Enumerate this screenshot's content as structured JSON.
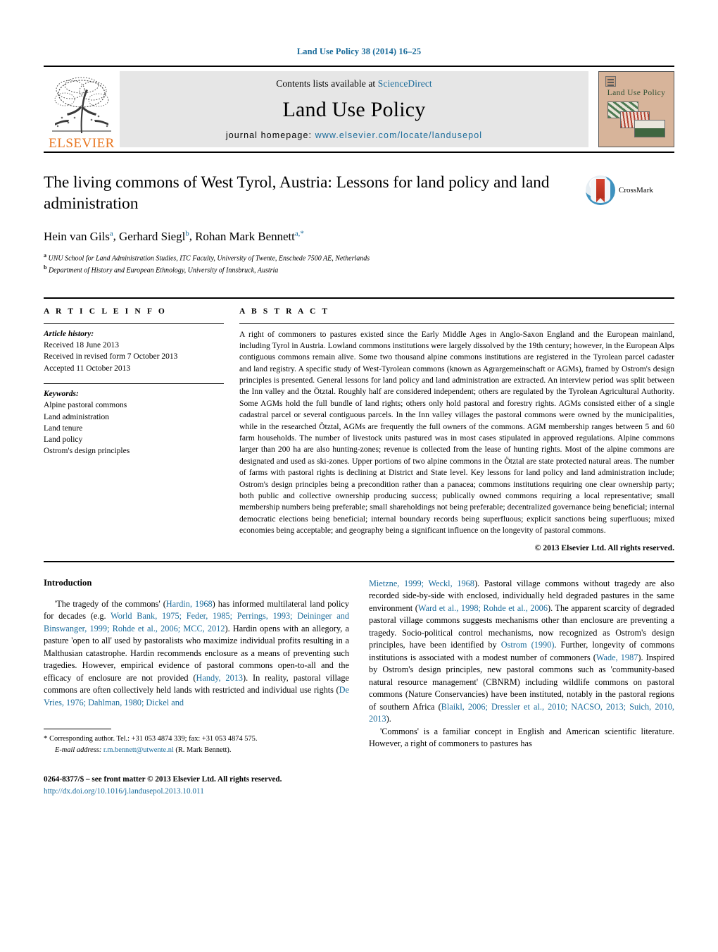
{
  "running_head": "Land Use Policy 38 (2014) 16–25",
  "masthead": {
    "publisher_name": "ELSEVIER",
    "contents_prefix": "Contents lists available at ",
    "contents_link": "ScienceDirect",
    "journal_title": "Land Use Policy",
    "homepage_prefix": "journal homepage: ",
    "homepage_url": "www.elsevier.com/locate/landusepol",
    "cover_title": "Land Use Policy"
  },
  "article": {
    "title": "The living commons of West Tyrol, Austria: Lessons for land policy and land administration",
    "authors": [
      {
        "name": "Hein van Gils",
        "marks": "a"
      },
      {
        "name": "Gerhard Siegl",
        "marks": "b"
      },
      {
        "name": "Rohan Mark Bennett",
        "marks": "a,*"
      }
    ],
    "authors_line_plain": "Hein van Gils a, Gerhard Siegl b, Rohan Mark Bennett a,*",
    "affiliations": [
      {
        "mark": "a",
        "text": "UNU School for Land Administration Studies, ITC Faculty, University of Twente, Enschede 7500 AE, Netherlands"
      },
      {
        "mark": "b",
        "text": "Department of History and European Ethnology, University of Innsbruck, Austria"
      }
    ],
    "crossmark_label": "CrossMark"
  },
  "article_info": {
    "heading": "A R T I C L E   I N F O",
    "history_label": "Article history:",
    "history": [
      "Received 18 June 2013",
      "Received in revised form 7 October 2013",
      "Accepted 11 October 2013"
    ],
    "keywords_label": "Keywords:",
    "keywords": [
      "Alpine pastoral commons",
      "Land administration",
      "Land tenure",
      "Land policy",
      "Ostrom's design principles"
    ]
  },
  "abstract": {
    "heading": "A B S T R A C T",
    "text": "A right of commoners to pastures existed since the Early Middle Ages in Anglo-Saxon England and the European mainland, including Tyrol in Austria. Lowland commons institutions were largely dissolved by the 19th century; however, in the European Alps contiguous commons remain alive. Some two thousand alpine commons institutions are registered in the Tyrolean parcel cadaster and land registry. A specific study of West-Tyrolean commons (known as Agrargemeinschaft or AGMs), framed by Ostrom's design principles is presented. General lessons for land policy and land administration are extracted. An interview period was split between the Inn valley and the Ötztal. Roughly half are considered independent; others are regulated by the Tyrolean Agricultural Authority. Some AGMs hold the full bundle of land rights; others only hold pastoral and forestry rights. AGMs consisted either of a single cadastral parcel or several contiguous parcels. In the Inn valley villages the pastoral commons were owned by the municipalities, while in the researched Ötztal, AGMs are frequently the full owners of the commons. AGM membership ranges between 5 and 60 farm households. The number of livestock units pastured was in most cases stipulated in approved regulations. Alpine commons larger than 200 ha are also hunting-zones; revenue is collected from the lease of hunting rights. Most of the alpine commons are designated and used as ski-zones. Upper portions of two alpine commons in the Ötztal are state protected natural areas. The number of farms with pastoral rights is declining at District and State level. Key lessons for land policy and land administration include; Ostrom's design principles being a precondition rather than a panacea; commons institutions requiring one clear ownership party; both public and collective ownership producing success; publically owned commons requiring a local representative; small membership numbers being preferable; small shareholdings not being preferable; decentralized governance being beneficial; internal democratic elections being beneficial; internal boundary records being superfluous; explicit sanctions being superfluous; mixed economies being acceptable; and geography being a significant influence on the longevity of pastoral commons.",
    "copyright": "© 2013 Elsevier Ltd. All rights reserved."
  },
  "introduction": {
    "heading": "Introduction",
    "left_paragraph_1": "'The tragedy of the commons' (Hardin, 1968) has informed multilateral land policy for decades (e.g. World Bank, 1975; Feder, 1985; Perrings, 1993; Deininger and Binswanger, 1999; Rohde et al., 2006; MCC, 2012). Hardin opens with an allegory, a pasture 'open to all' used by pastoralists who maximize individual profits resulting in a Malthusian catastrophe. Hardin recommends enclosure as a means of preventing such tragedies. However, empirical evidence of pastoral commons open-to-all and the efficacy of enclosure are not provided (Handy, 2013). In reality, pastoral village commons are often collectively held lands with restricted and individual use rights (De Vries, 1976; Dahlman, 1980; Dickel and",
    "right_paragraph_1": "Mietzne, 1999; Weckl, 1968). Pastoral village commons without tragedy are also recorded side-by-side with enclosed, individually held degraded pastures in the same environment (Ward et al., 1998; Rohde et al., 2006). The apparent scarcity of degraded pastoral village commons suggests mechanisms other than enclosure are preventing a tragedy. Socio-political control mechanisms, now recognized as Ostrom's design principles, have been identified by Ostrom (1990). Further, longevity of commons institutions is associated with a modest number of commoners (Wade, 1987). Inspired by Ostrom's design principles, new pastoral commons such as 'community-based natural resource management' (CBNRM) including wildlife commons on pastoral commons (Nature Conservancies) have been instituted, notably in the pastoral regions of southern Africa (Blaikl, 2006; Dressler et al., 2010; NACSO, 2013; Suich, 2010, 2013).",
    "right_paragraph_2": "'Commons' is a familiar concept in English and American scientific literature. However, a right of commoners to pastures has"
  },
  "footnote": {
    "star": "*",
    "corresponding": "Corresponding author. Tel.: +31 053 4874 339; fax: +31 053 4874 575.",
    "email_label": "E-mail address:",
    "email": "r.m.bennett@utwente.nl",
    "email_owner": "(R. Mark Bennett)."
  },
  "footer": {
    "issn_line": "0264-8377/$ – see front matter © 2013 Elsevier Ltd. All rights reserved.",
    "doi": "http://dx.doi.org/10.1016/j.landusepol.2013.10.011"
  },
  "colors": {
    "link": "#1a6b9a",
    "elsevier_orange": "#E87722",
    "band_gray": "#e6e6e6",
    "cover_tan": "#d7b49a"
  }
}
